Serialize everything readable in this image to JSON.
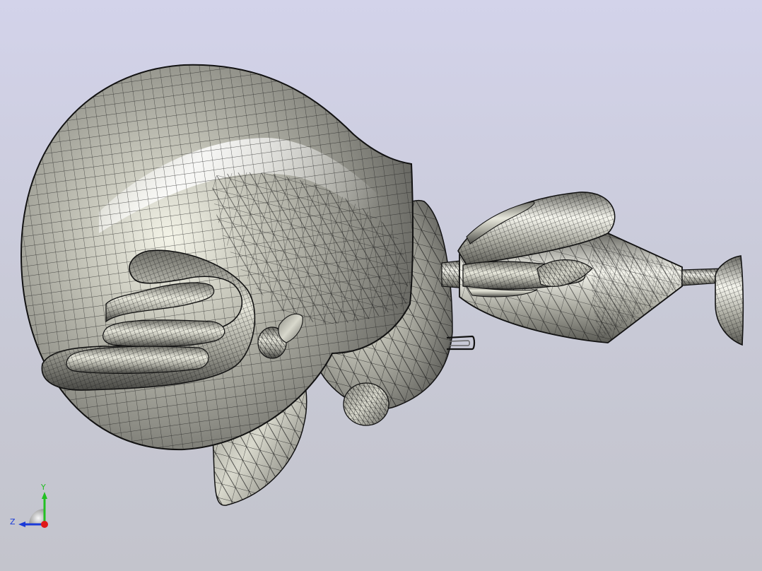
{
  "viewport": {
    "background_top": "#d3d3ea",
    "background_bottom": "#c3c4cc",
    "model_color": "#9a9a90",
    "mesh_color": "#1a1a1a"
  },
  "triad": {
    "y_label": "Y",
    "z_label": "Z",
    "y_color": "#22c022",
    "z_color": "#1a3ad8",
    "x_color": "#e01818"
  }
}
